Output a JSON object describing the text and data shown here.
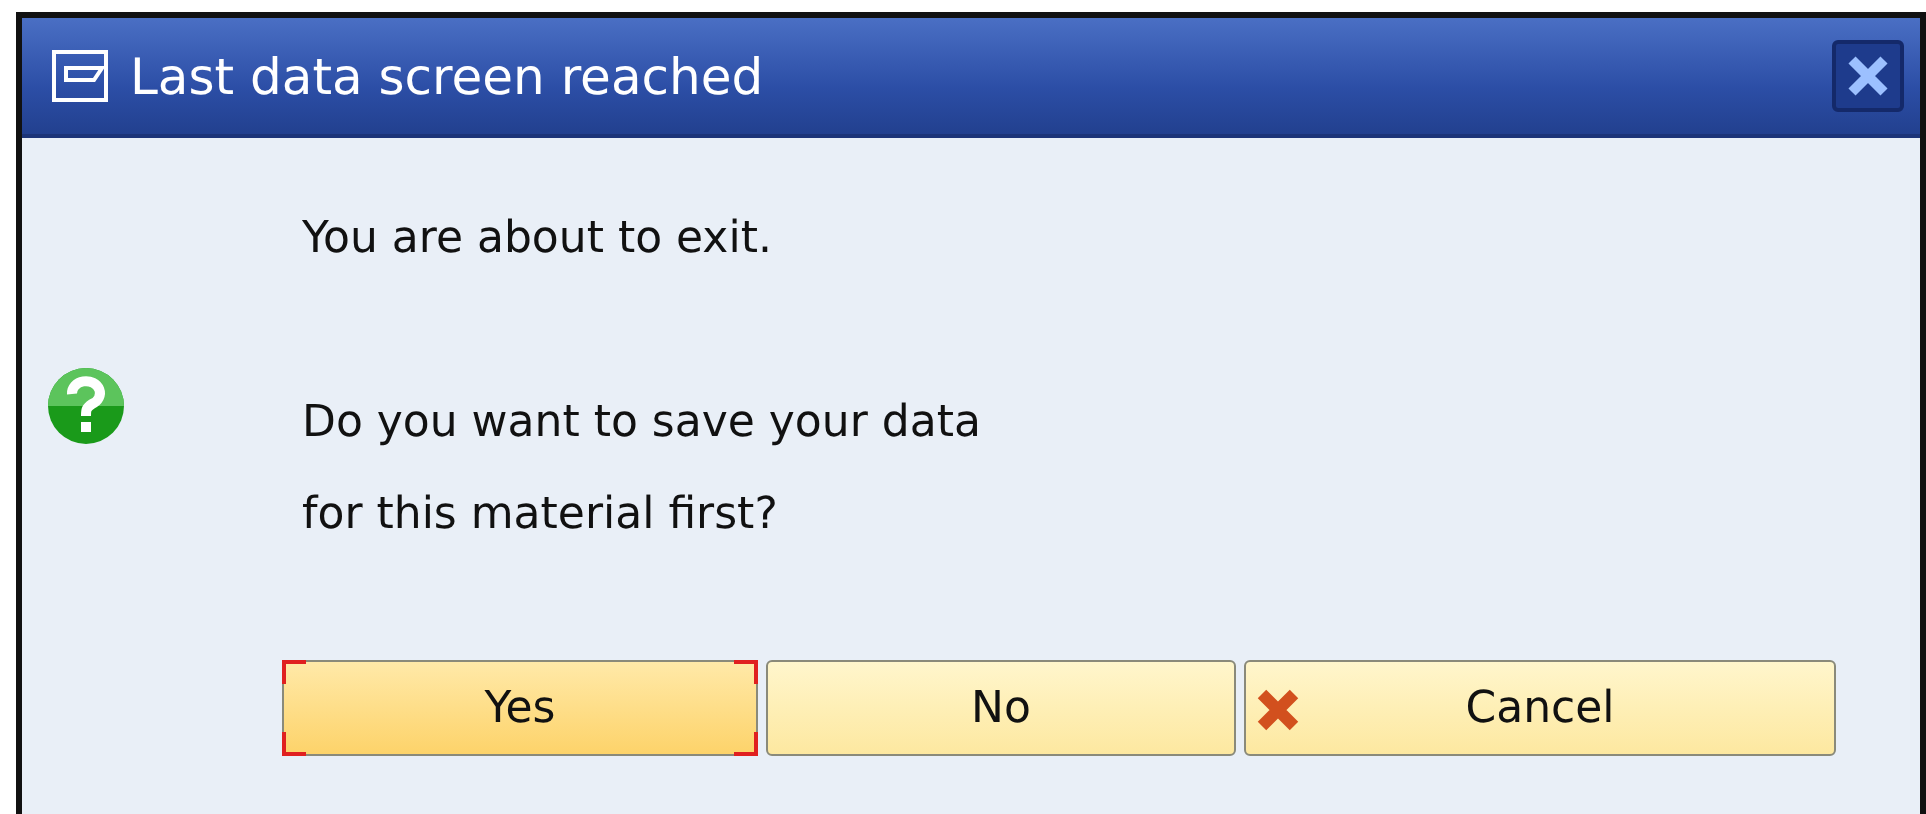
{
  "window": {
    "title": "Last data screen reached"
  },
  "message": {
    "lines": [
      "You are about to exit.",
      "Do you want to save your data",
      "for this material first?"
    ]
  },
  "buttons": [
    {
      "label": "Yes",
      "kind": "plain",
      "focused": true
    },
    {
      "label": "No",
      "kind": "plain",
      "focused": false
    },
    {
      "label": "Cancel",
      "kind": "cancel",
      "focused": false
    }
  ]
}
